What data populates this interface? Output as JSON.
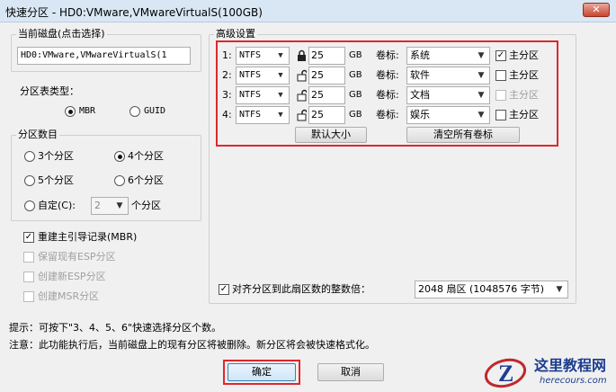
{
  "window": {
    "title": "快速分区 - HD0:VMware,VMwareVirtualS(100GB)",
    "close": "✕"
  },
  "disk": {
    "legend": "当前磁盘(点击选择)",
    "value": "HD0:VMware,VMwareVirtualS(1"
  },
  "ptype": {
    "label": "分区表类型：",
    "mbr": "MBR",
    "guid": "GUID",
    "selected": "MBR"
  },
  "pcount": {
    "legend": "分区数目",
    "o3": "3个分区",
    "o4": "4个分区",
    "o5": "5个分区",
    "o6": "6个分区",
    "custom": "自定(C):",
    "custom_value": "2",
    "custom_suffix": "个分区",
    "selected": "4个分区"
  },
  "options": {
    "rebuild_mbr": "重建主引导记录(MBR)",
    "rebuild_mbr_checked": true,
    "keep_esp": "保留现有ESP分区",
    "create_esp": "创建新ESP分区",
    "create_msr": "创建MSR分区"
  },
  "advanced": {
    "legend": "高级设置",
    "rows": [
      {
        "idx": "1:",
        "fs": "NTFS",
        "lock": "locked",
        "size": "25",
        "unit": "GB",
        "vol_label": "卷标:",
        "vol": "系统",
        "primary": "主分区",
        "primary_checked": true,
        "primary_enabled": true
      },
      {
        "idx": "2:",
        "fs": "NTFS",
        "lock": "unlocked",
        "size": "25",
        "unit": "GB",
        "vol_label": "卷标:",
        "vol": "软件",
        "primary": "主分区",
        "primary_checked": false,
        "primary_enabled": true
      },
      {
        "idx": "3:",
        "fs": "NTFS",
        "lock": "unlocked",
        "size": "25",
        "unit": "GB",
        "vol_label": "卷标:",
        "vol": "文档",
        "primary": "主分区",
        "primary_checked": false,
        "primary_enabled": false
      },
      {
        "idx": "4:",
        "fs": "NTFS",
        "lock": "unlocked",
        "size": "25",
        "unit": "GB",
        "vol_label": "卷标:",
        "vol": "娱乐",
        "primary": "主分区",
        "primary_checked": false,
        "primary_enabled": true
      }
    ],
    "default_size_btn": "默认大小",
    "clear_labels_btn": "清空所有卷标"
  },
  "align": {
    "label": "对齐分区到此扇区数的整数倍：",
    "checked": true,
    "value": "2048 扇区 (1048576 字节)"
  },
  "hints": {
    "line1": "提示：可按下\"3、4、5、6\"快速选择分区个数。",
    "line2": "注意：此功能执行后，当前磁盘上的现有分区将被删除。新分区将会被快速格式化。"
  },
  "buttons": {
    "ok": "确定",
    "cancel": "取消"
  },
  "watermark": {
    "main": "这里教程网",
    "url": "herecours.com",
    "logo": "Z"
  },
  "colors": {
    "highlight": "#e1262d",
    "title_bg": "#d9e7f4"
  }
}
